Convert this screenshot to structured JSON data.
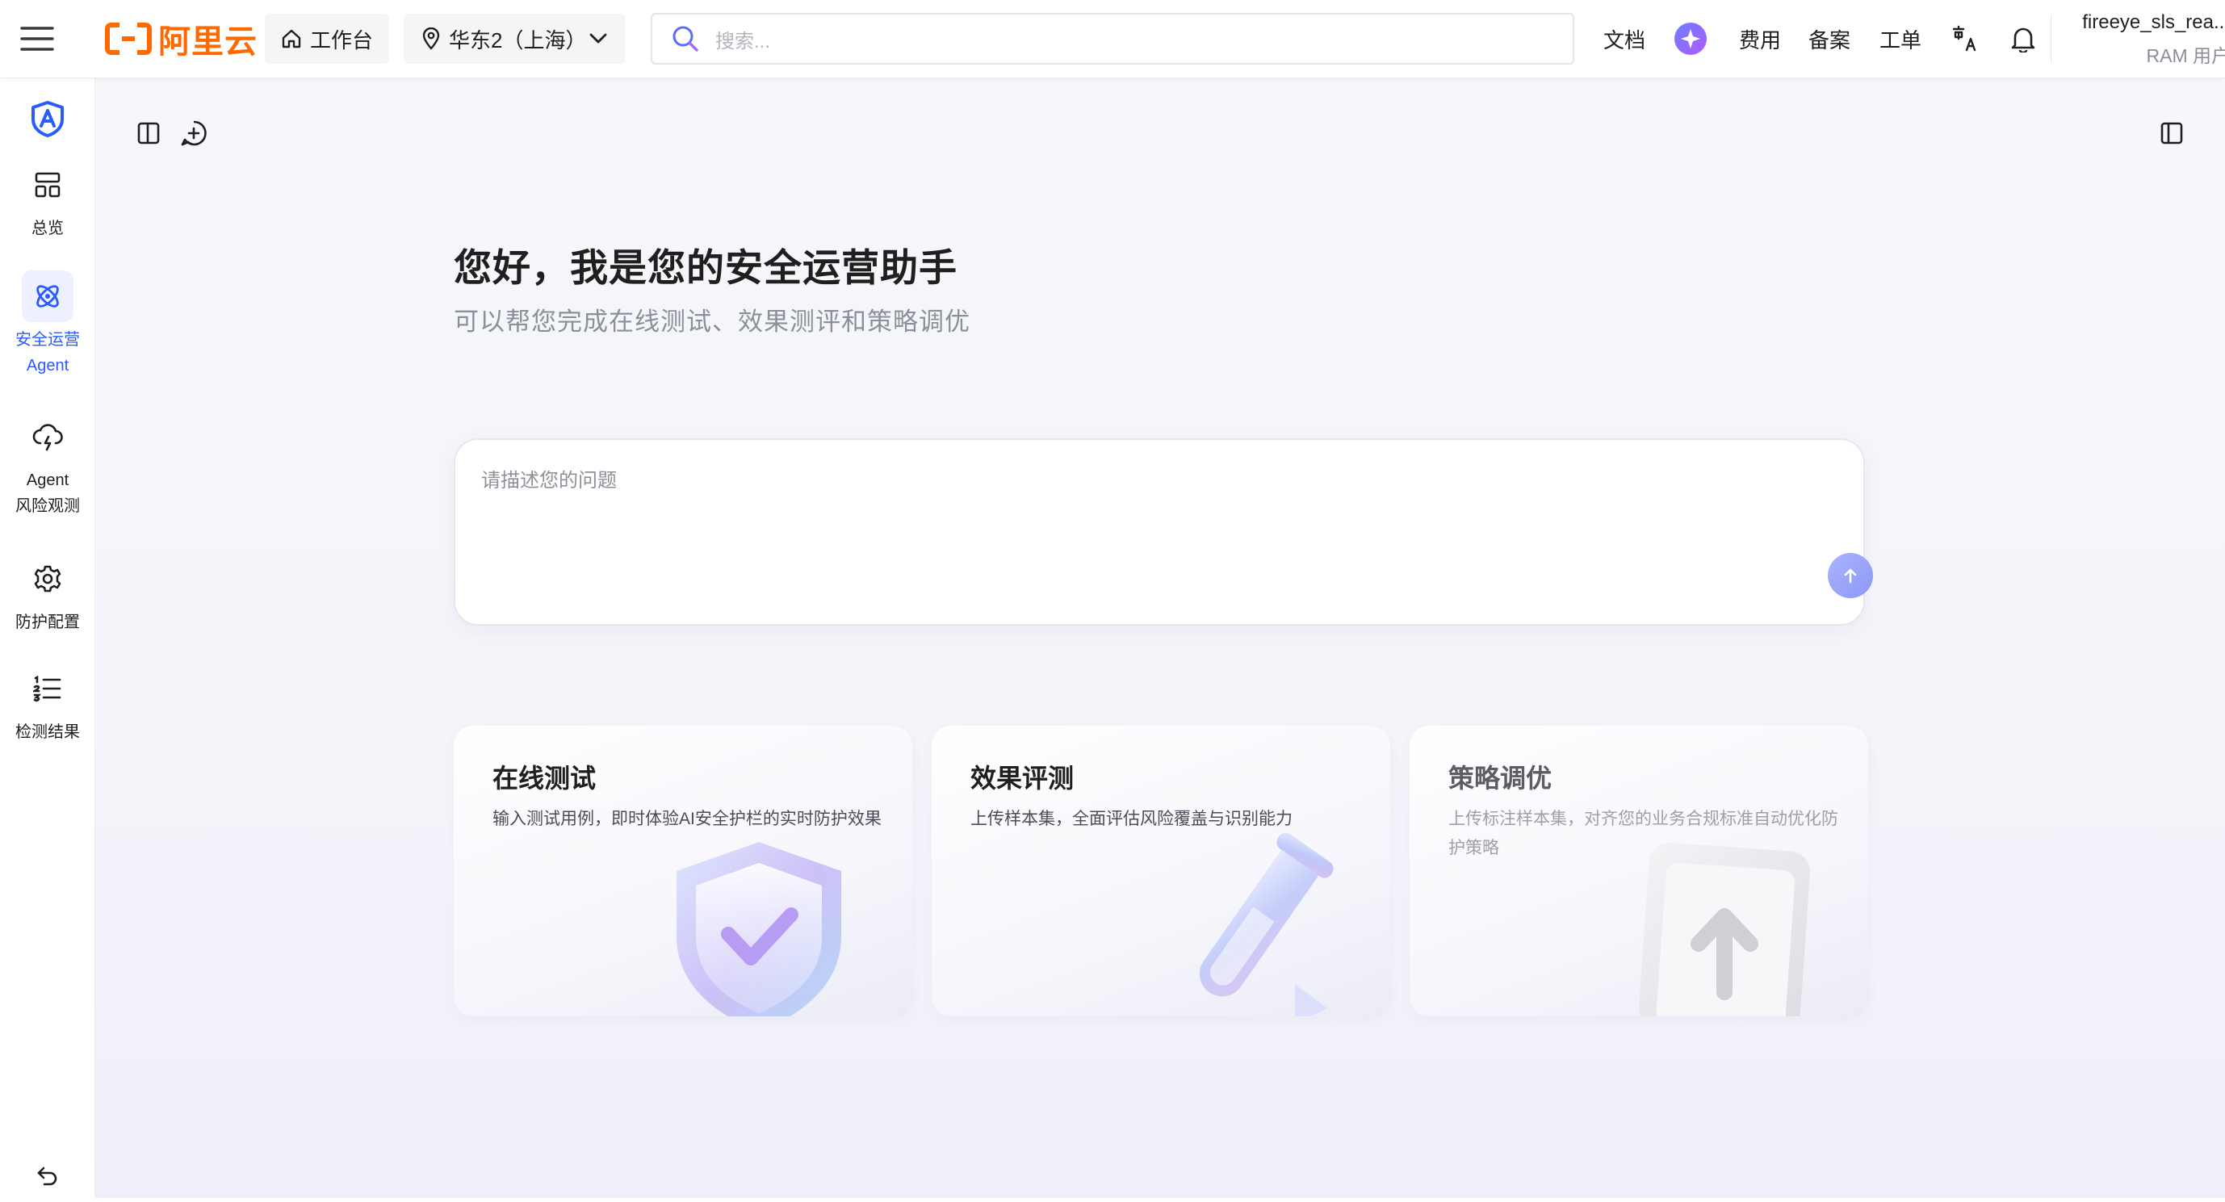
{
  "topbar": {
    "brand": "阿里云",
    "workbench_label": "工作台",
    "region_label": "华东2（上海）",
    "search_placeholder": "搜索...",
    "links": {
      "docs": "文档",
      "billing": "费用",
      "icp": "备案",
      "ticket": "工单"
    },
    "user": {
      "name": "fireeye_sls_rea...",
      "role": "RAM 用户"
    }
  },
  "sidebar": {
    "items": [
      {
        "label": "总览"
      },
      {
        "label": "安全运营",
        "label2": "Agent",
        "active": true
      },
      {
        "label": "Agent",
        "label2": "风险观测"
      },
      {
        "label": "防护配置"
      },
      {
        "label": "检测结果"
      }
    ]
  },
  "main": {
    "greeting": "您好，我是您的安全运营助手",
    "subtitle": "可以帮您完成在线测试、效果测评和策略调优",
    "input_placeholder": "请描述您的问题",
    "cards": [
      {
        "title": "在线测试",
        "desc": "输入测试用例，即时体验AI安全护栏的实时防护效果"
      },
      {
        "title": "效果评测",
        "desc": "上传样本集，全面评估风险覆盖与识别能力"
      },
      {
        "title": "策略调优",
        "desc": "上传标注样本集，对齐您的业务合规标准自动优化防护策略"
      }
    ]
  },
  "colors": {
    "brand_orange": "#ff6a00",
    "accent_blue": "#2a5bff",
    "send_button": "#a9b4ff"
  }
}
